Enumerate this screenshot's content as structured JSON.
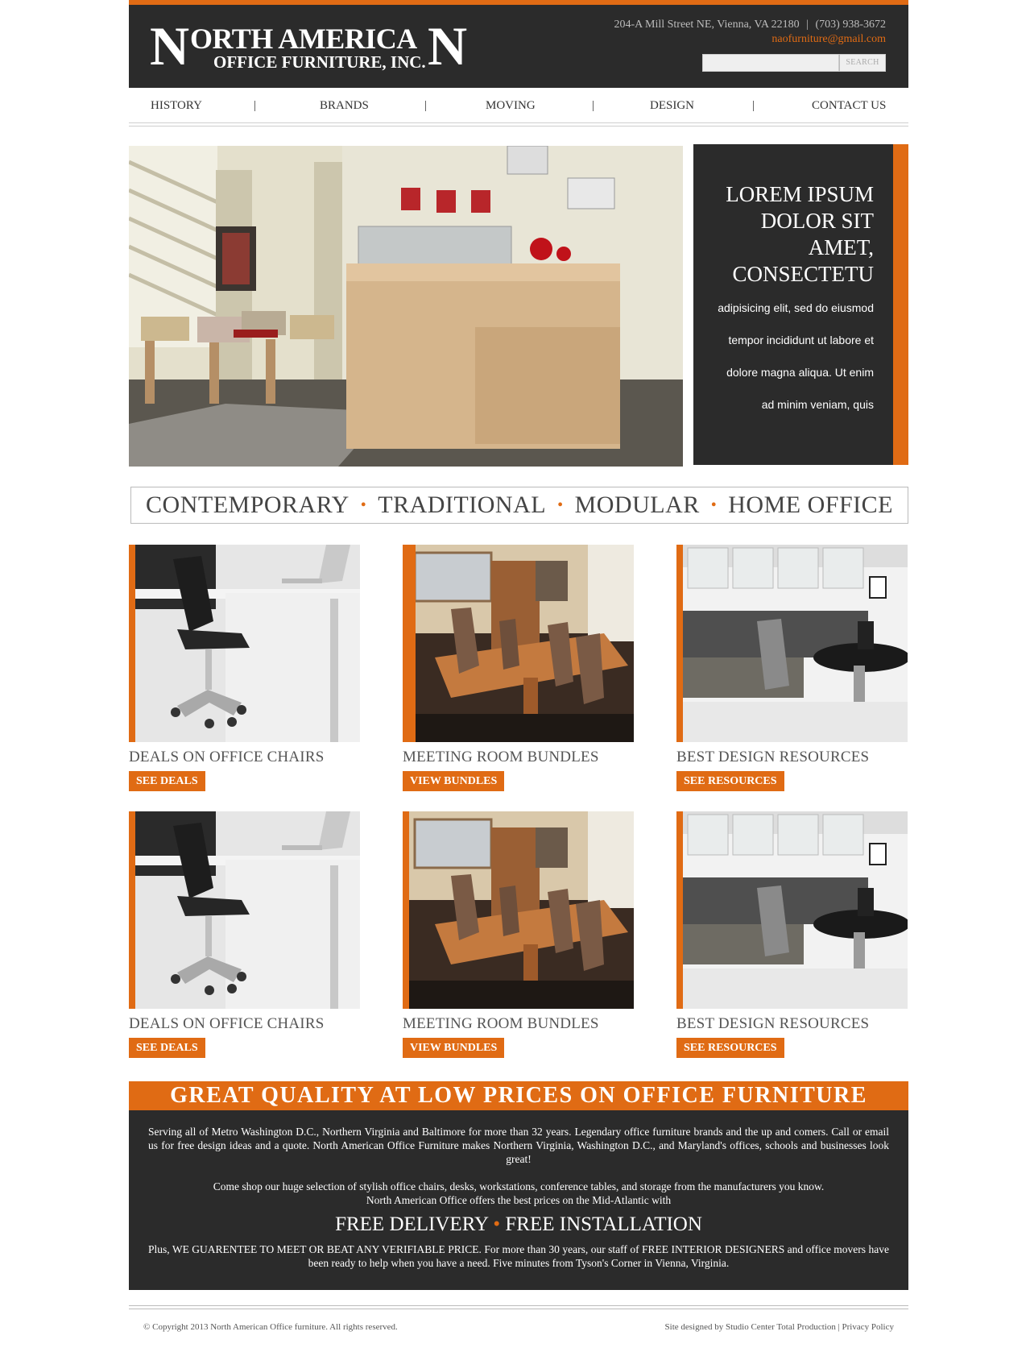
{
  "header": {
    "logo": {
      "first_letter": "N",
      "line1": "ORTH AMERICA",
      "last_letter": "N",
      "line2": "OFFICE FURNITURE, INC."
    },
    "address": "204-A Mill Street NE, Vienna, VA 22180",
    "separator": "|",
    "phone": "(703) 938-3672",
    "email": "naofurniture@gmail.com",
    "search_button": "SEARCH"
  },
  "nav": {
    "items": [
      "HISTORY",
      "BRANDS",
      "MOVING",
      "DESIGN",
      "CONTACT US"
    ],
    "separator": "|"
  },
  "hero": {
    "title_lines": [
      "LOREM IPSUM",
      "DOLOR SIT",
      "AMET,",
      "CONSECTETU"
    ],
    "body_lines": [
      "adipisicing elit, sed do eiusmod",
      "tempor incididunt ut labore et",
      "dolore magna aliqua. Ut enim",
      "ad minim veniam, quis"
    ]
  },
  "categories": [
    "CONTEMPORARY",
    "TRADITIONAL",
    "MODULAR",
    "HOME OFFICE"
  ],
  "category_separator": "•",
  "cards": [
    {
      "title": "DEALS ON OFFICE CHAIRS",
      "button": "SEE DEALS",
      "image": "office-chair-photo"
    },
    {
      "title": "MEETING ROOM BUNDLES",
      "button": "VIEW BUNDLES",
      "image": "conference-room-photo"
    },
    {
      "title": "BEST DESIGN RESOURCES",
      "button": "SEE RESOURCES",
      "image": "workstation-photo"
    },
    {
      "title": "DEALS ON OFFICE CHAIRS",
      "button": "SEE DEALS",
      "image": "office-chair-photo"
    },
    {
      "title": "MEETING ROOM BUNDLES",
      "button": "VIEW BUNDLES",
      "image": "conference-room-photo"
    },
    {
      "title": "BEST DESIGN RESOURCES",
      "button": "SEE RESOURCES",
      "image": "workstation-photo"
    }
  ],
  "promo": {
    "heading": "GREAT QUALITY AT LOW PRICES ON OFFICE FURNITURE",
    "paragraph1": "Serving all of Metro Washington D.C., Northern Virginia and Baltimore for more than 32 years. Legendary office furniture brands and the up and comers. Call or email us for free design ideas and a quote. North American Office Furniture makes Northern Virginia, Washington D.C., and Maryland's offices, schools and businesses look great!",
    "paragraph2_line1": "Come shop our huge selection of stylish office chairs, desks, workstations, conference tables, and storage from the manufacturers you know.",
    "paragraph2_line2": "North American Office offers the best prices on the Mid-Atlantic with",
    "free_delivery": "FREE DELIVERY",
    "free_separator": "•",
    "free_installation": "FREE INSTALLATION",
    "paragraph3": "Plus, WE GUARENTEE TO MEET OR BEAT ANY VERIFIABLE PRICE.  For more than 30 years, our staff of FREE INTERIOR DESIGNERS and office movers have been ready to help when you have a need.  Five minutes from Tyson's Corner in Vienna, Virginia."
  },
  "footer": {
    "copyright": "© Copyright 2013 North American Office furniture. All rights reserved.",
    "credit": "Site designed by Studio Center Total Production",
    "separator": "|",
    "privacy": "Privacy Policy"
  },
  "colors": {
    "accent": "#e06b14",
    "dark": "#2b2b2b"
  }
}
